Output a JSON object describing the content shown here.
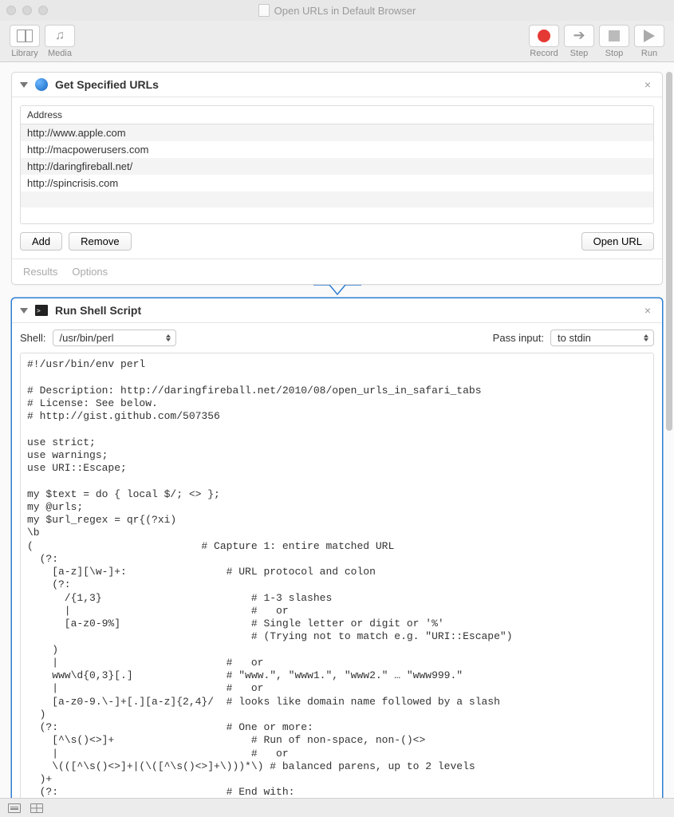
{
  "window": {
    "title": "Open URLs in Default Browser"
  },
  "toolbar": {
    "library": "Library",
    "media": "Media",
    "record": "Record",
    "step": "Step",
    "stop": "Stop",
    "run": "Run"
  },
  "action1": {
    "title": "Get Specified URLs",
    "address_header": "Address",
    "urls": [
      "http://www.apple.com",
      "http://macpowerusers.com",
      "http://daringfireball.net/",
      "http://spincrisis.com"
    ],
    "add": "Add",
    "remove": "Remove",
    "open_url": "Open URL",
    "results": "Results",
    "options": "Options"
  },
  "action2": {
    "title": "Run Shell Script",
    "shell_label": "Shell:",
    "shell_value": "/usr/bin/perl",
    "pass_input_label": "Pass input:",
    "pass_input_value": "to stdin",
    "script": "#!/usr/bin/env perl\n\n# Description: http://daringfireball.net/2010/08/open_urls_in_safari_tabs\n# License: See below.\n# http://gist.github.com/507356\n\nuse strict;\nuse warnings;\nuse URI::Escape;\n\nmy $text = do { local $/; <> };\nmy @urls;\nmy $url_regex = qr{(?xi)\n\\b\n(                           # Capture 1: entire matched URL\n  (?:\n    [a-z][\\w-]+:                # URL protocol and colon\n    (?:\n      /{1,3}                        # 1-3 slashes\n      |                             #   or\n      [a-z0-9%]                     # Single letter or digit or '%'\n                                    # (Trying not to match e.g. \"URI::Escape\")\n    )\n    |                           #   or\n    www\\d{0,3}[.]               # \"www.\", \"www1.\", \"www2.\" … \"www999.\"\n    |                           #   or\n    [a-z0-9.\\-]+[.][a-z]{2,4}/  # looks like domain name followed by a slash\n  )\n  (?:                           # One or more:\n    [^\\s()<>]+                      # Run of non-space, non-()<>\n    |                               #   or\n    \\(([^\\s()<>]+|(\\([^\\s()<>]+\\)))*\\) # balanced parens, up to 2 levels\n  )+\n  (?:                           # End with:"
  }
}
